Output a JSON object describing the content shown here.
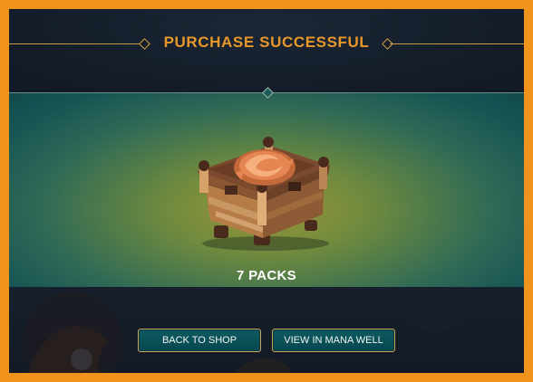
{
  "dialog": {
    "title": "PURCHASE SUCCESSFUL"
  },
  "reward": {
    "item_icon": "chest-icon",
    "label": "7 PACKS"
  },
  "buttons": {
    "back_to_shop": "BACK TO SHOP",
    "view_in_mana_well": "VIEW IN MANA WELL"
  },
  "colors": {
    "border": "#f0931c",
    "title": "#e8982a",
    "button_fill": "#0e5a62",
    "button_border": "#c7a55a"
  }
}
